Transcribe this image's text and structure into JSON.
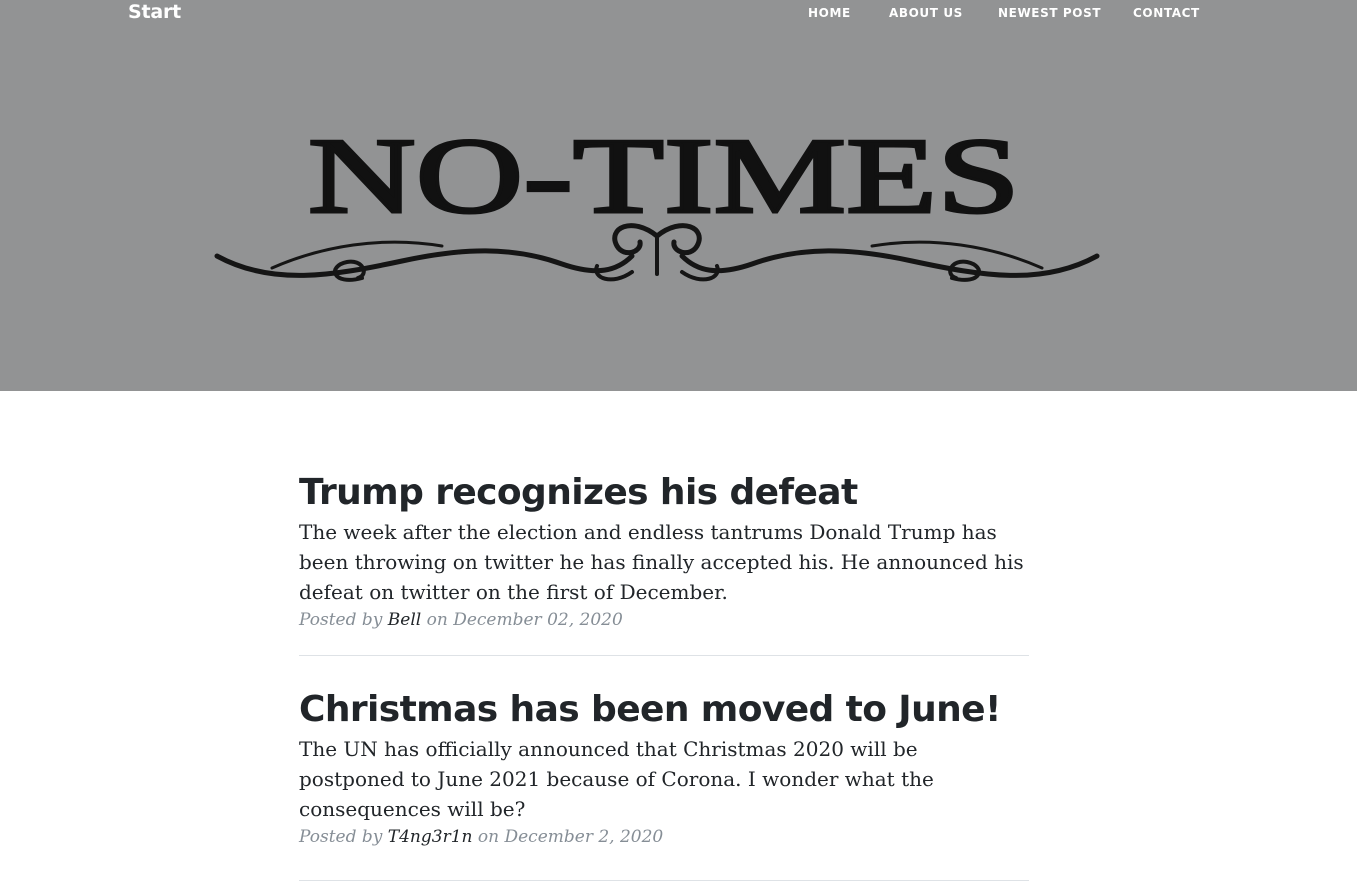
{
  "nav": {
    "brand": "Start",
    "links": [
      {
        "label": "HOME"
      },
      {
        "label": "ABOUT US"
      },
      {
        "label": "NEWEST POST"
      },
      {
        "label": "CONTACT"
      }
    ]
  },
  "header": {
    "logo_text": "NO-TIMES",
    "background_color": "#929394"
  },
  "posts": [
    {
      "title": "Trump recognizes his defeat",
      "subtitle": "The week after the election and endless tantrums Donald Trump has been throwing on twitter he has finally accepted his. He announced his defeat on twitter on the first of December.",
      "meta_prefix": "Posted by",
      "author": "Bell",
      "meta_suffix": "on December 02, 2020"
    },
    {
      "title": "Christmas has been moved to June!",
      "subtitle": "The UN has officially announced that Christmas 2020 will be postponed to June 2021 because of Corona. I wonder what the consequences will be?",
      "meta_prefix": "Posted by",
      "author": "T4ng3r1n",
      "meta_suffix": "on December 2, 2020"
    }
  ],
  "colors": {
    "text": "#212529",
    "meta": "#868e96",
    "divider": "#dee2e6"
  }
}
